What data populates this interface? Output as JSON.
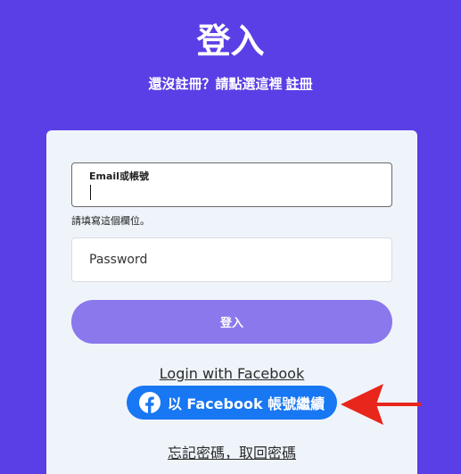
{
  "header": {
    "title": "登入",
    "subtitle_prefix": "還沒註冊？請點選這裡",
    "register_link": "註冊"
  },
  "form": {
    "email_label": "Email或帳號",
    "email_value": "",
    "email_hint": "請填寫這個欄位。",
    "password_placeholder": "Password",
    "login_button": "登入"
  },
  "facebook": {
    "login_text": "Login with Facebook",
    "continue_button": "以 Facebook 帳號繼續",
    "icon": "facebook-icon"
  },
  "forgot_password": "忘記密碼，取回密碼",
  "colors": {
    "background": "#5a3fe6",
    "card": "#eff4fb",
    "login_button": "#8a78ec",
    "facebook_blue": "#1877f2",
    "annotation_arrow": "#e8261b"
  }
}
